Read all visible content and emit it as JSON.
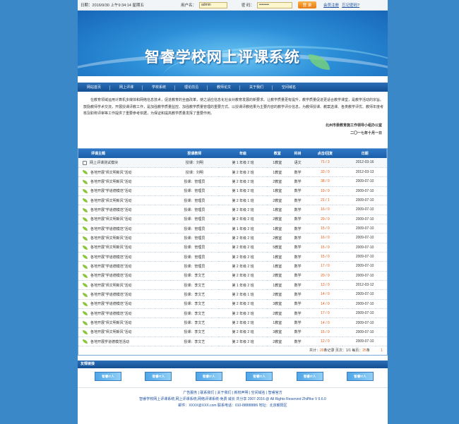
{
  "topbar": {
    "date_label": "日期：",
    "date_value": "2016/9/30 上午9:34:14 星期五",
    "username_label": "用户名：",
    "username_value": "admin",
    "password_label": "密 码：",
    "password_value": "••••••••",
    "login_label": "登 录",
    "register_label": "会员注册",
    "forgot_label": "忘记密码?"
  },
  "banner": {
    "title": "智睿学校网上评课系统"
  },
  "nav": [
    "网站首页",
    "网上评课",
    "学校系统",
    "理论前沿",
    "教师论文",
    "关于我们",
    "空间域名"
  ],
  "notice": {
    "text": "在教育领域运用计算机多媒体和网络信息技术，促进教育的全面改革，使之适应信息化社会对教育发展的新要求。让教学质量更有提升，教学质量促进更适合教学课堂，是教学活动的宗旨。鼓励教师学术交流，开展授课评教工作，是加强教学质量监控、加强教学质量管理的重要方式。以授课评教结果为主要内容的教学评价信息，为教师授课、教案选课、各类教学评优、教师年度考核及职称评审等工作提供了重要参考依据，为保证和提高教学质量发挥了重要作用。",
    "signer": "北州市委教育施工作领导小组办公室",
    "sign_date": "二〇一七年十月一日"
  },
  "table": {
    "headers": [
      "评课主题",
      "授课教师",
      "年级",
      "教室",
      "科目",
      "点击/回复",
      "日期"
    ],
    "rows": [
      {
        "topic": "网上评课测试模块",
        "teacher": "授课：刘明",
        "grade": "第 1 年级 2 班",
        "room": "1教室",
        "subject": "语文",
        "stat": "71 / 3",
        "date": "2012-03-16",
        "icon": "doc"
      },
      {
        "topic": "各地开展\"师文明新风\"活动",
        "teacher": "授课：刘明",
        "grade": "第 2 年级 2 班",
        "room": "1教室",
        "subject": "数学",
        "stat": "33 / 0",
        "date": "2012-03-13",
        "icon": "leaf"
      },
      {
        "topic": "各地开展\"师文明新风\"活动",
        "teacher": "授课：管理员",
        "grade": "第 2 年级 2 班",
        "room": "2教室",
        "subject": "数学",
        "stat": "38 / 0",
        "date": "2009-07-10",
        "icon": "leaf"
      },
      {
        "topic": "各地开展\"学道德模范\"活动",
        "teacher": "授课：管理员",
        "grade": "第 1 年级 2 班",
        "room": "1教室",
        "subject": "数学",
        "stat": "19 / 0",
        "date": "2009-07-10",
        "icon": "leaf"
      },
      {
        "topic": "各地开展\"师文明新风\"活动",
        "teacher": "授课：管理员",
        "grade": "第 2 年级 1 班",
        "room": "2教室",
        "subject": "数学",
        "stat": "21 / 1",
        "date": "2009-07-10",
        "icon": "leaf"
      },
      {
        "topic": "各地开展\"学道德模范\"活动",
        "teacher": "授课：管理员",
        "grade": "第 2 年级 2 班",
        "room": "1教室",
        "subject": "数学",
        "stat": "16 / 0",
        "date": "2009-07-10",
        "icon": "leaf"
      },
      {
        "topic": "各地开展\"师文明新风\"活动",
        "teacher": "授课：管理员",
        "grade": "第 2 年级 2 班",
        "room": "2教室",
        "subject": "数学",
        "stat": "29 / 0",
        "date": "2009-07-10",
        "icon": "leaf"
      },
      {
        "topic": "各地开展\"学道德模范\"活动",
        "teacher": "授课：管理员",
        "grade": "第 1 年级 2 班",
        "room": "1教室",
        "subject": "数学",
        "stat": "15 / 0",
        "date": "2009-07-10",
        "icon": "leaf"
      },
      {
        "topic": "各地开展\"师文明新风\"活动",
        "teacher": "授课：管理员",
        "grade": "第 2 年级 2 班",
        "room": "2教室",
        "subject": "数学",
        "stat": "16 / 0",
        "date": "2009-07-10",
        "icon": "leaf"
      },
      {
        "topic": "各地开展\"师文明新风\"活动",
        "teacher": "授课：管理员",
        "grade": "第 2 年级 2 班",
        "room": "5教室",
        "subject": "数学",
        "stat": "15 / 0",
        "date": "2009-07-10",
        "icon": "leaf"
      },
      {
        "topic": "各地开展\"学道德模范\"活动",
        "teacher": "授课：管理员",
        "grade": "第 2 年级 2 班",
        "room": "1教室",
        "subject": "数学",
        "stat": "15 / 0",
        "date": "2009-07-10",
        "icon": "leaf"
      },
      {
        "topic": "各地开展\"学道德模范\"活动",
        "teacher": "授课：管理员",
        "grade": "第 2 年级 2 班",
        "room": "1教室",
        "subject": "数学",
        "stat": "17 / 0",
        "date": "2009-07-10",
        "icon": "leaf"
      },
      {
        "topic": "各地开展\"学道德模范\"活动",
        "teacher": "授课：李文艺",
        "grade": "第 2 年级 2 班",
        "room": "2教室",
        "subject": "数学",
        "stat": "20 / 0",
        "date": "2009-07-10",
        "icon": "leaf"
      },
      {
        "topic": "各地开展\"师文明新风\"活动",
        "teacher": "授课：李文艺",
        "grade": "第 1 年级 2 班",
        "room": "1教室",
        "subject": "数学",
        "stat": "13 / 0",
        "date": "2012-03-12",
        "icon": "leaf"
      },
      {
        "topic": "各地开展\"学道德模范\"活动",
        "teacher": "授课：李文艺",
        "grade": "第 2 年级 1 班",
        "room": "2教室",
        "subject": "数学",
        "stat": "14 / 0",
        "date": "2009-07-10",
        "icon": "leaf"
      },
      {
        "topic": "各地开展\"学道德模范\"活动",
        "teacher": "授课：李文艺",
        "grade": "第 2 年级 2 班",
        "room": "3教室",
        "subject": "数学",
        "stat": "14 / 0",
        "date": "2009-07-10",
        "icon": "leaf"
      },
      {
        "topic": "各地开展\"学道德模范\"活动",
        "teacher": "授课：李文艺",
        "grade": "第 2 年级 2 班",
        "room": "2教室",
        "subject": "数学",
        "stat": "17 / 0",
        "date": "2009-07-10",
        "icon": "leaf"
      },
      {
        "topic": "各地开展\"师文明新风\"活动",
        "teacher": "授课：李文艺",
        "grade": "第 2 年级 2 班",
        "room": "1教室",
        "subject": "数学",
        "stat": "14 / 0",
        "date": "2009-07-10",
        "icon": "leaf"
      },
      {
        "topic": "各地开展\"师文明新风\"活动",
        "teacher": "授课：李文艺",
        "grade": "第 2 年级 2 班",
        "room": "3教室",
        "subject": "数学",
        "stat": "15 / 0",
        "date": "2009-07-10",
        "icon": "leaf"
      },
      {
        "topic": "各地开展学道德模范活动",
        "teacher": "授课：李文艺",
        "grade": "第 2 年级 2 班",
        "room": "2教室",
        "subject": "数学",
        "stat": "12 / 0",
        "date": "2009-07-10",
        "icon": "leaf"
      }
    ],
    "footer": {
      "total_prefix": "共计：",
      "total": "20",
      "total_suffix": "条记录 页次：",
      "page": "1/1",
      "per_page_prefix": " 每页：",
      "per_page": "25",
      "per_page_suffix": "条",
      "page_link": "1"
    }
  },
  "friends": {
    "title": "友情链接",
    "items": [
      "智睿IT人",
      "智睿IT人",
      "智睿IT人",
      "智睿IT人",
      "智睿IT人",
      "智睿IT人"
    ]
  },
  "footer": {
    "links": [
      "广告服务",
      "联系我们",
      "关于我们",
      "新权声明",
      "空间域名",
      "智睿官方"
    ],
    "line1": "智睿学校网上评课系统,网上评课系统,网络评课系统-免费 威长 共分享 2007-2016 @ All Rights Reserved ZhiPike V 6.6.0",
    "line2": "邮件：XXXX@XXX.com 联系电话：010-88888886 地址：北京朝阳区"
  },
  "colors": {
    "page_bg": "#3a88c8",
    "nav_bg": "#1f5ea3",
    "accent_orange": "#e8540c",
    "link_blue": "#1a4fa0"
  }
}
